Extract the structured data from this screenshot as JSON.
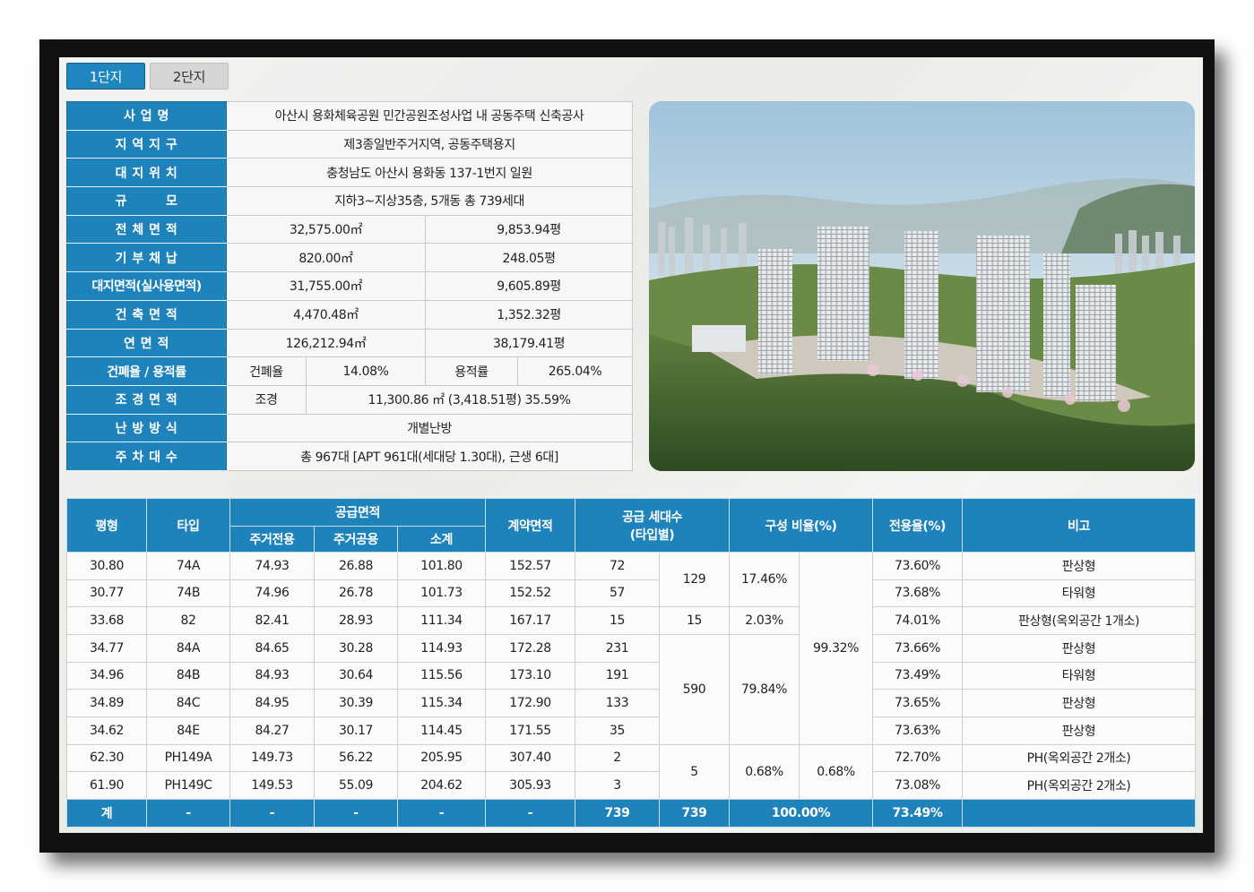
{
  "tabs": [
    "1단지",
    "2단지"
  ],
  "info": {
    "project": {
      "label": "사 업 명",
      "value": "아산시 용화체육공원 민간공원조성사업 내 공동주택 신축공사"
    },
    "zone": {
      "label": "지 역 지 구",
      "value": "제3종일반주거지역, 공동주택용지"
    },
    "location": {
      "label": "대 지 위 치",
      "value": "충청남도 아산시 용화동 137-1번지 일원"
    },
    "scale": {
      "label": "규        모",
      "value": "지하3~지상35층, 5개동 총 739세대"
    },
    "total_area": {
      "label": "전 체 면 적",
      "m2": "32,575.00㎡",
      "pyeong": "9,853.94평"
    },
    "donation": {
      "label": "기 부 채 납",
      "m2": "820.00㎡",
      "pyeong": "248.05평"
    },
    "site_area": {
      "label": "대지면적(실사용면적)",
      "m2": "31,755.00㎡",
      "pyeong": "9,605.89평"
    },
    "building_area": {
      "label": "건 축 면 적",
      "m2": "4,470.48㎡",
      "pyeong": "1,352.32평"
    },
    "floor_area": {
      "label": "연 면 적",
      "m2": "126,212.94㎡",
      "pyeong": "38,179.41평"
    },
    "ratio": {
      "label": "건폐율 / 용적률",
      "bcr_label": "건폐율",
      "bcr": "14.08%",
      "far_label": "용적률",
      "far": "265.04%"
    },
    "landscape": {
      "label": "조 경 면 적",
      "sub": "조경",
      "value": "11,300.86 ㎡ (3,418.51평) 35.59%"
    },
    "heating": {
      "label": "난 방 방 식",
      "value": "개별난방"
    },
    "parking": {
      "label": "주 차 대 수",
      "value": "총 967대 [APT 961대(세대당 1.30대), 근생 6대]"
    }
  },
  "table": {
    "headers": {
      "pyeong": "평형",
      "type": "타입",
      "supply": "공급면적",
      "excl": "주거전용",
      "common": "주거공용",
      "subtotal": "소계",
      "contract": "계약면적",
      "units": "공급 세대수\n(타입별)",
      "ratio": "구성 비율(%)",
      "exclusive_ratio": "전용율(%)",
      "note": "비고"
    },
    "rows": [
      {
        "pyeong": "30.80",
        "type": "74A",
        "excl": "74.93",
        "common": "26.88",
        "subtotal": "101.80",
        "contract": "152.57",
        "units": "72",
        "erate": "73.60%",
        "note": "판상형"
      },
      {
        "pyeong": "30.77",
        "type": "74B",
        "excl": "74.96",
        "common": "26.78",
        "subtotal": "101.73",
        "contract": "152.52",
        "units": "57",
        "erate": "73.68%",
        "note": "타워형"
      },
      {
        "pyeong": "33.68",
        "type": "82",
        "excl": "82.41",
        "common": "28.93",
        "subtotal": "111.34",
        "contract": "167.17",
        "units": "15",
        "erate": "74.01%",
        "note": "판상형(옥외공간 1개소)"
      },
      {
        "pyeong": "34.77",
        "type": "84A",
        "excl": "84.65",
        "common": "30.28",
        "subtotal": "114.93",
        "contract": "172.28",
        "units": "231",
        "erate": "73.66%",
        "note": "판상형"
      },
      {
        "pyeong": "34.96",
        "type": "84B",
        "excl": "84.93",
        "common": "30.64",
        "subtotal": "115.56",
        "contract": "173.10",
        "units": "191",
        "erate": "73.49%",
        "note": "타워형"
      },
      {
        "pyeong": "34.89",
        "type": "84C",
        "excl": "84.95",
        "common": "30.39",
        "subtotal": "115.34",
        "contract": "172.90",
        "units": "133",
        "erate": "73.65%",
        "note": "판상형"
      },
      {
        "pyeong": "34.62",
        "type": "84E",
        "excl": "84.27",
        "common": "30.17",
        "subtotal": "114.45",
        "contract": "171.55",
        "units": "35",
        "erate": "73.63%",
        "note": "판상형"
      },
      {
        "pyeong": "62.30",
        "type": "PH149A",
        "excl": "149.73",
        "common": "56.22",
        "subtotal": "205.95",
        "contract": "307.40",
        "units": "2",
        "erate": "72.70%",
        "note": "PH(옥외공간 2개소)"
      },
      {
        "pyeong": "61.90",
        "type": "PH149C",
        "excl": "149.53",
        "common": "55.09",
        "subtotal": "204.62",
        "contract": "305.93",
        "units": "3",
        "erate": "73.08%",
        "note": "PH(옥외공간 2개소)"
      }
    ],
    "groups": {
      "g1": {
        "units": "129",
        "ratio": "17.46%"
      },
      "g2": {
        "units": "15",
        "ratio": "2.03%"
      },
      "g3": {
        "units": "590",
        "ratio": "79.84%"
      },
      "g4": {
        "units": "5",
        "ratio": "0.68%"
      },
      "sum_main": "99.32%",
      "sum_ph": "0.68%"
    },
    "total": {
      "label": "계",
      "dash": "-",
      "units": "739",
      "units_total": "739",
      "ratio": "100.00%",
      "erate": "73.49%"
    }
  }
}
